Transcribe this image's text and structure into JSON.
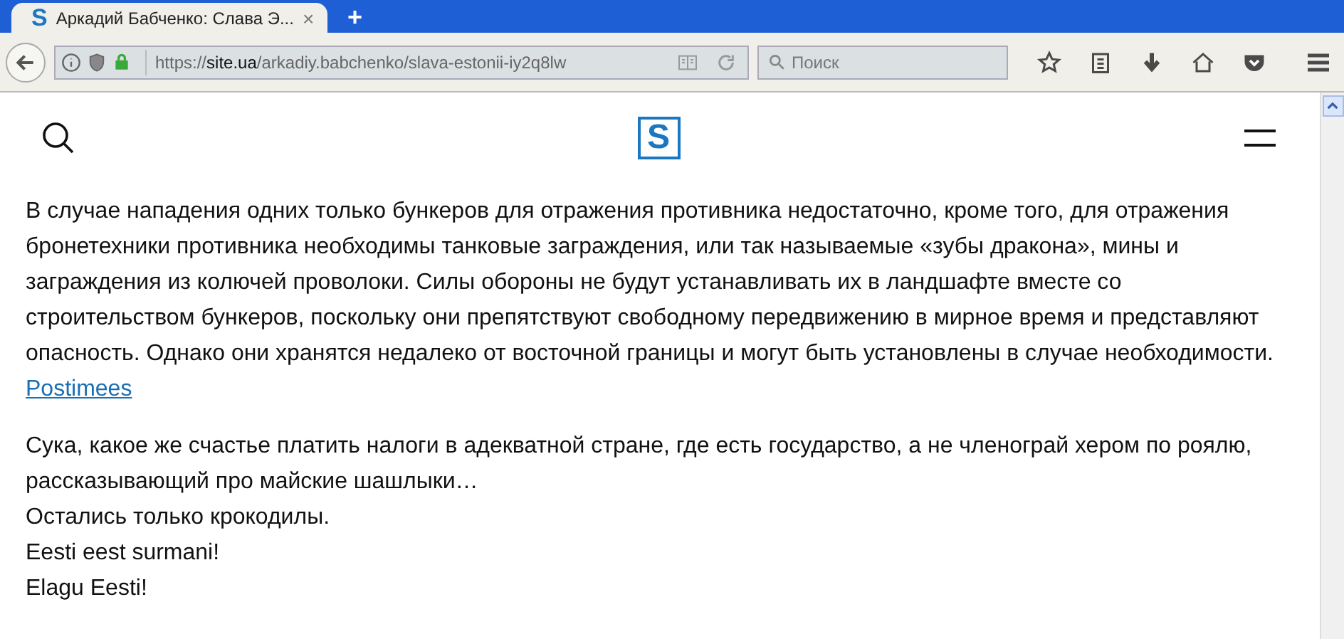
{
  "tab": {
    "favicon": "S",
    "title": "Аркадий Бабченко: Слава Э...",
    "close": "×",
    "selected": true
  },
  "new_tab": "+",
  "address_bar": {
    "scheme": "https://",
    "host": "site.ua",
    "path": "/arkadiy.babchenko/slava-estonii-iy2q8lw",
    "secure": true
  },
  "search": {
    "placeholder": "Поиск"
  },
  "site_header": {
    "logo": "S"
  },
  "article": {
    "paragraphs": [
      {
        "kind": "text",
        "text": "В случае нападения одних только бункеров для отражения противника недостаточно, кроме того, для отражения бронетехники противника необходимы танковые заграждения, или так называемые «зубы дракона», мины и заграждения из колючей проволоки. Силы обороны не будут устанавливать их в ландшафте вместе со строительством бункеров, поскольку они препятствуют свободному передвижению в мирное время и представляют опасность. Однако они хранятся недалеко от восточной границы и могут быть установлены в случае необходимости."
      },
      {
        "kind": "link",
        "text": "Postimees"
      },
      {
        "kind": "gap"
      },
      {
        "kind": "text",
        "text": "Сука, какое же счастье платить налоги в адекватной стране, где есть государство, а не членограй хером по роялю, рассказывающий про майские шашлыки…"
      },
      {
        "kind": "text",
        "text": "Остались только крокодилы."
      },
      {
        "kind": "text",
        "text": "Eesti eest surmani!"
      },
      {
        "kind": "text",
        "text": "Elagu Eesti!"
      }
    ]
  }
}
